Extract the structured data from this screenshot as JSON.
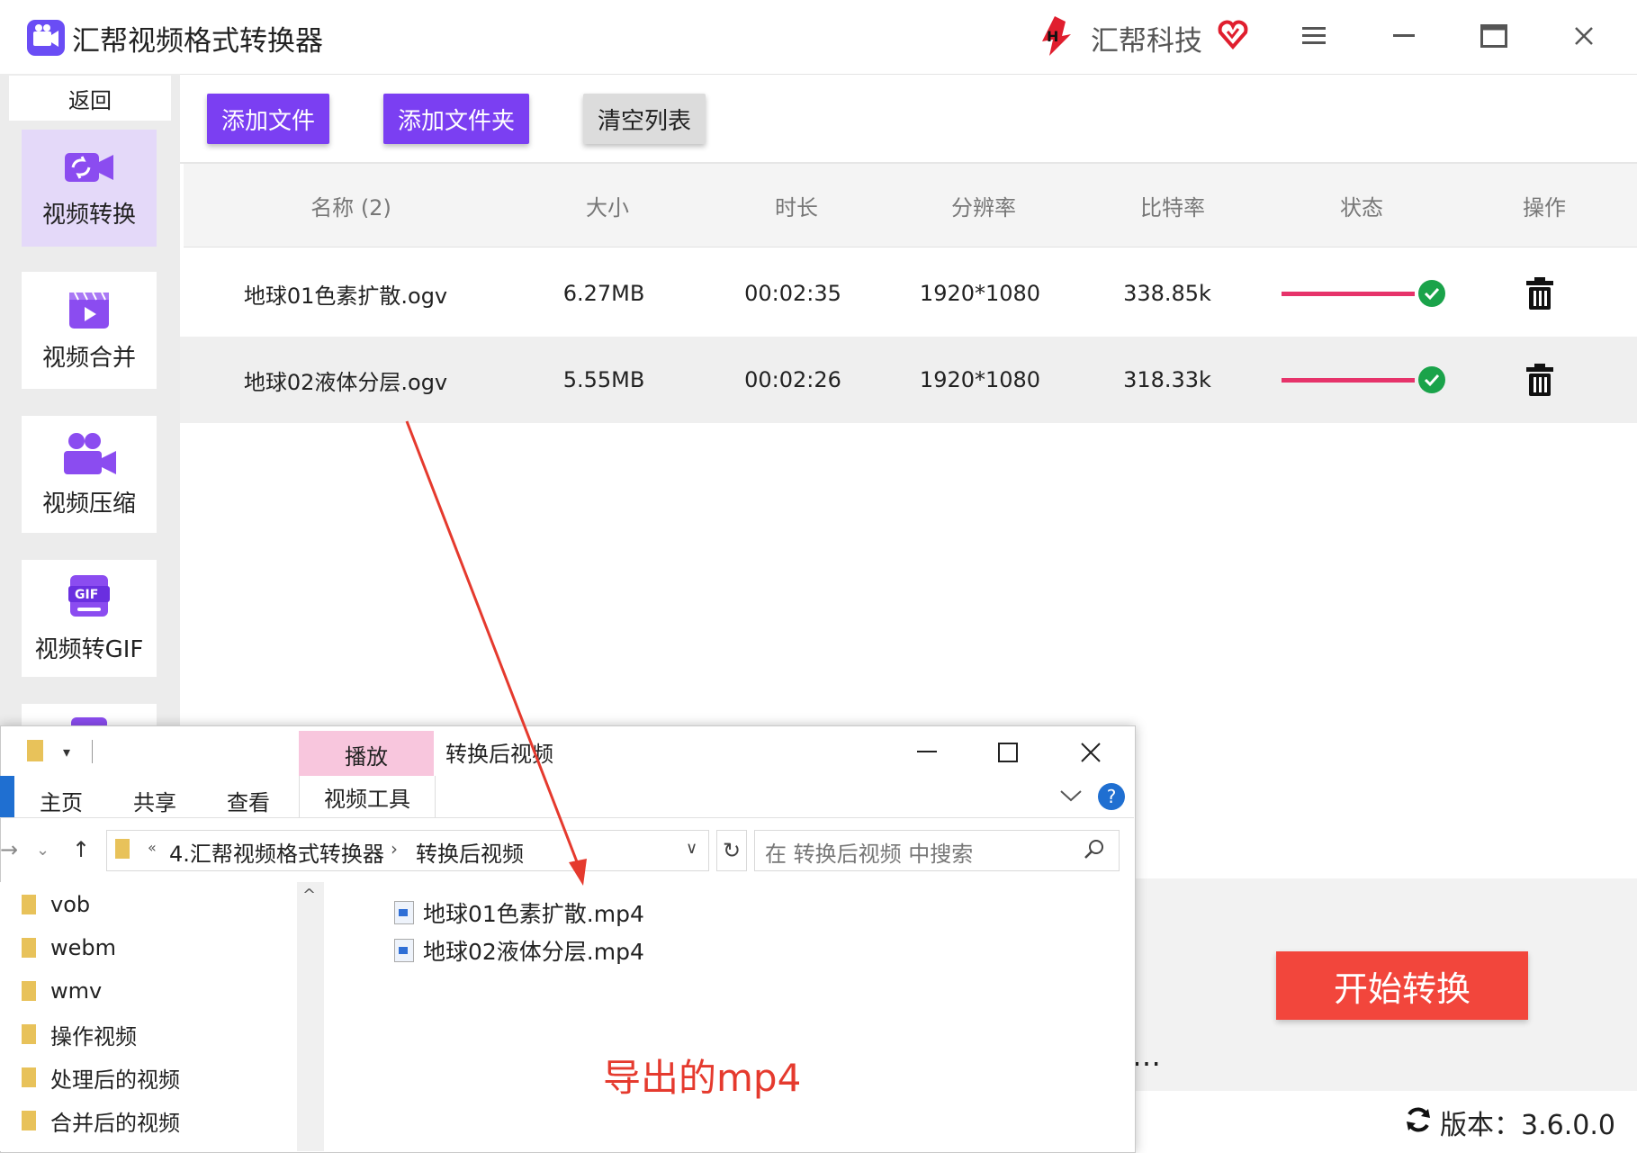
{
  "app": {
    "title": "汇帮视频格式转换器",
    "brand": "汇帮科技",
    "accent_color": "#7b3ff2",
    "start_color": "#f2463c"
  },
  "window_controls": {
    "menu_icon": "hamburger-icon",
    "minimize_icon": "minimize-icon",
    "maximize_icon": "maximize-icon",
    "close_icon": "close-icon"
  },
  "sidebar": {
    "back_label": "返回",
    "items": [
      {
        "label": "视频转换",
        "icon": "video-convert-icon",
        "active": true
      },
      {
        "label": "视频合并",
        "icon": "video-merge-icon",
        "active": false
      },
      {
        "label": "视频压缩",
        "icon": "video-compress-icon",
        "active": false
      },
      {
        "label": "视频转GIF",
        "icon": "gif-icon",
        "active": false
      }
    ]
  },
  "toolbar": {
    "add_file": "添加文件",
    "add_folder": "添加文件夹",
    "clear_list": "清空列表"
  },
  "table": {
    "headers": [
      "名称 (2)",
      "大小",
      "时长",
      "分辨率",
      "比特率",
      "状态",
      "操作"
    ],
    "rows": [
      {
        "name": "地球01色素扩散.ogv",
        "size": "6.27MB",
        "duration": "00:02:35",
        "resolution": "1920*1080",
        "bitrate": "338.85k",
        "progress": 1.0,
        "status_icon": "check-circle-icon",
        "action_icon": "trash-icon"
      },
      {
        "name": "地球02液体分层.ogv",
        "size": "5.55MB",
        "duration": "00:02:26",
        "resolution": "1920*1080",
        "bitrate": "318.33k",
        "progress": 1.0,
        "status_icon": "check-circle-icon",
        "action_icon": "trash-icon"
      }
    ]
  },
  "bottom": {
    "start_label": "开始转换",
    "more_label": "…",
    "version_label": "版本：3.6.0.0"
  },
  "explorer": {
    "title": "转换后视频",
    "play_tab": "播放",
    "ribbon_tabs": [
      "主页",
      "共享",
      "查看"
    ],
    "video_tools_tab": "视频工具",
    "address": {
      "seg1": "4.汇帮视频格式转换器",
      "seg2": "转换后视频"
    },
    "search_placeholder": "在 转换后视频 中搜索",
    "tree": [
      "vob",
      "webm",
      "wmv",
      "操作视频",
      "处理后的视频",
      "合并后的视频"
    ],
    "files": [
      "地球01色素扩散.mp4",
      "地球02液体分层.mp4"
    ]
  },
  "annotation": {
    "text": "导出的mp4",
    "color": "#e53a2e"
  }
}
